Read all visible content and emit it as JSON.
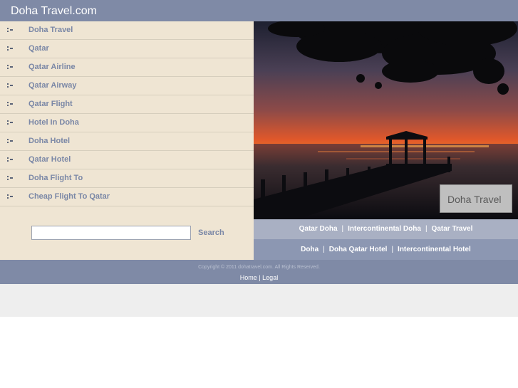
{
  "header": {
    "title": "Doha Travel.com"
  },
  "nav": {
    "items": [
      {
        "label": "Doha Travel"
      },
      {
        "label": "Qatar"
      },
      {
        "label": "Qatar Airline"
      },
      {
        "label": "Qatar Airway"
      },
      {
        "label": "Qatar Flight"
      },
      {
        "label": "Hotel In Doha"
      },
      {
        "label": "Doha Hotel"
      },
      {
        "label": "Qatar Hotel"
      },
      {
        "label": "Doha Flight To"
      },
      {
        "label": "Cheap Flight To Qatar"
      }
    ]
  },
  "search": {
    "value": "",
    "button_label": "Search"
  },
  "hero": {
    "badge_text": "Doha Travel"
  },
  "links_row1": [
    "Qatar Doha",
    "Intercontinental Doha",
    "Qatar Travel"
  ],
  "links_row2": [
    "Doha",
    "Doha Qatar Hotel",
    "Intercontinental Hotel"
  ],
  "link_separator": "|",
  "footer": {
    "copyright": "Copyright © 2011 dohatravel.com. All Rights Reserved.",
    "home_label": "Home",
    "separator": "|",
    "legal_label": "Legal"
  },
  "colors": {
    "header_bg": "#7f8aa6",
    "sidebar_bg": "#efe5d3",
    "nav_text": "#7a87a6",
    "link_bar_1": "#a9b0c3",
    "link_bar_2": "#8c97b2",
    "footer_bg": "#7f8aa6"
  }
}
